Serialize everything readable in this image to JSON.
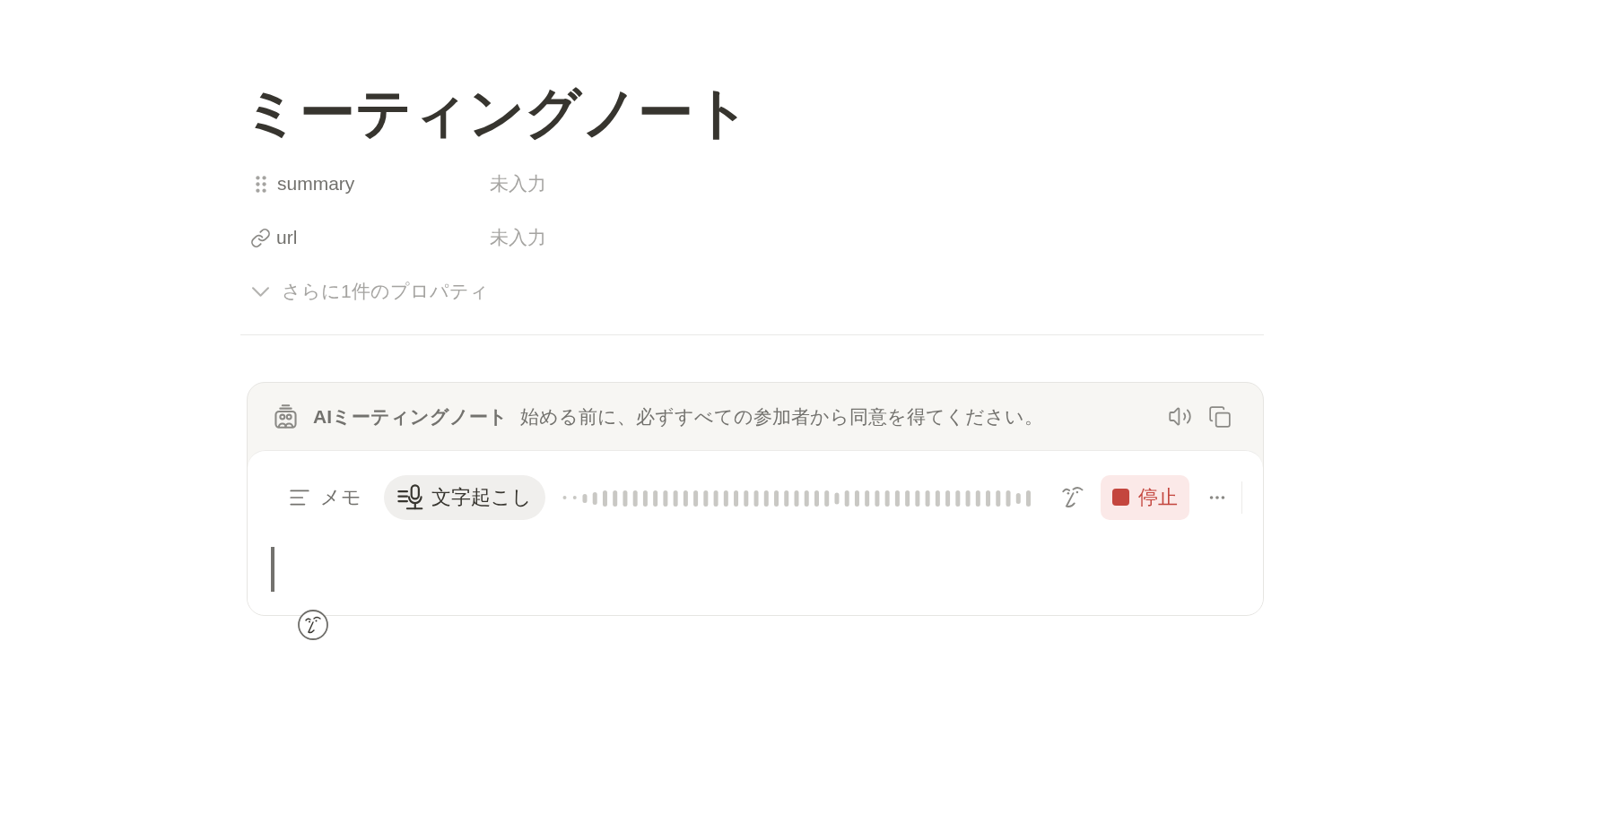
{
  "page_title": "ミーティングノート",
  "properties": [
    {
      "kind": "text",
      "name": "summary",
      "placeholder": "未入力"
    },
    {
      "kind": "url",
      "name": "url",
      "placeholder": "未入力"
    }
  ],
  "more_properties": {
    "label": "さらに1件のプロパティ",
    "expanded": false
  },
  "ai_notes": {
    "title": "AIミーティングノート",
    "notice": "始める前に、必ずすべての参加者から同意を得てください。",
    "tabs": [
      {
        "kind": "notes",
        "label": "メモ",
        "selected": false
      },
      {
        "kind": "transcript",
        "label": "文字起こし",
        "selected": true
      }
    ],
    "recording": true,
    "stop_button": "停止",
    "editor": {
      "focused": true
    }
  }
}
